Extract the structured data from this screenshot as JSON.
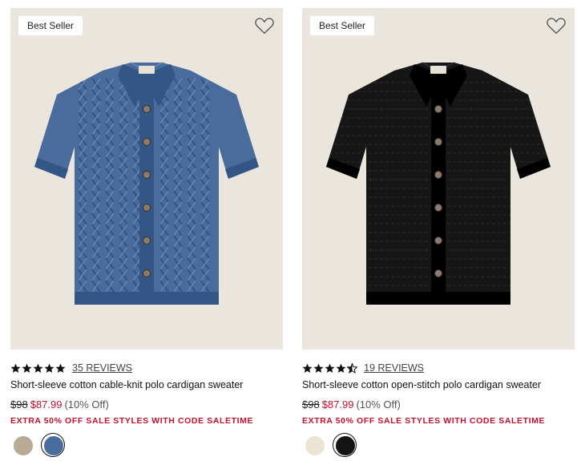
{
  "products": [
    {
      "badge": "Best Seller",
      "rating_value": 5,
      "stars": [
        "full",
        "full",
        "full",
        "full",
        "full"
      ],
      "reviews": "35 REVIEWS",
      "name": "Short-sleeve cotton cable-knit polo cardigan sweater",
      "original_price": "$98",
      "sale_price": "$87.99",
      "discount": "(10% Off)",
      "promo": "EXTRA 50% OFF SALE STYLES WITH CODE SALETIME",
      "garment_color": "#4a6c9c",
      "garment_pattern": "cable-knit",
      "swatches": [
        {
          "name": "oatmeal cable",
          "color": "#b9aa96",
          "selected": false
        },
        {
          "name": "blue cable",
          "color": "#4a6c9c",
          "selected": true
        }
      ]
    },
    {
      "badge": "Best Seller",
      "rating_value": 4.5,
      "stars": [
        "full",
        "full",
        "full",
        "full",
        "half"
      ],
      "reviews": "19 REVIEWS",
      "name": "Short-sleeve cotton open-stitch polo cardigan sweater",
      "original_price": "$98",
      "sale_price": "$87.99",
      "discount": "(10% Off)",
      "promo": "EXTRA 50% OFF SALE STYLES WITH CODE SALETIME",
      "garment_color": "#161616",
      "garment_pattern": "open-stitch",
      "swatches": [
        {
          "name": "ivory",
          "color": "#ece4d3",
          "selected": false
        },
        {
          "name": "black",
          "color": "#141414",
          "selected": true
        }
      ]
    }
  ],
  "colors": {
    "image_bg": "#ebe6dd",
    "sale_red": "#c8102e",
    "star": "#111111"
  }
}
